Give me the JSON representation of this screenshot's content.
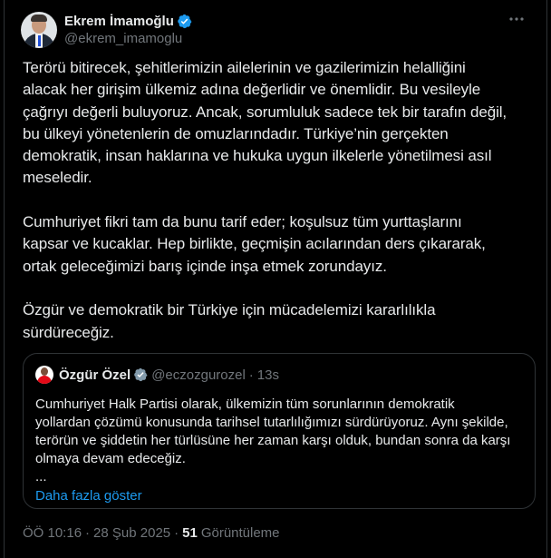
{
  "tweet": {
    "author": {
      "display_name": "Ekrem İmamoğlu",
      "handle": "@ekrem_imamoglu",
      "verified": true
    },
    "more_icon": "more-horizontal-icon",
    "paragraphs": [
      "Terörü bitirecek, şehitlerimizin ailelerinin ve gazilerimizin helalliğini\nalacak her girişim ülkemiz adına değerlidir ve önemlidir. Bu vesileyle\nçağrıyı değerli buluyoruz. Ancak, sorumluluk sadece tek bir tarafın değil,\nbu ülkeyi yönetenlerin de omuzlarındadır. Türkiye’nin gerçekten\ndemokratik, insan haklarına ve hukuka uygun ilkelerle yönetilmesi asıl\nmeseledir.",
      "Cumhuriyet fikri tam da bunu tarif eder; koşulsuz tüm yurttaşlarını\nkapsar ve kucaklar. Hep birlikte, geçmişin acılarından ders çıkararak,\nortak geleceğimizi barış içinde inşa etmek zorundayız.",
      "Özgür ve demokratik bir Türkiye için mücadelemizi kararlılıkla\nsürdüreceğiz."
    ],
    "quoted": {
      "display_name": "Özgür Özel",
      "handle": "@eczozgurozel",
      "dot": "·",
      "time": "13s",
      "text": "Cumhuriyet Halk Partisi olarak, ülkemizin tüm sorunlarının demokratik\nyollardan çözümü konusunda tarihsel tutarlılığımızı sürdürüyoruz. Aynı şekilde,\nterörün ve şiddetin her türlüsüne her zaman karşı olduk, bundan sonra da karşı\nolmaya devam edeceğiz.",
      "ellipsis": "...",
      "show_more": "Daha fazla göster"
    },
    "meta": {
      "time": "ÖÖ 10:16",
      "sep": "·",
      "date": "28 Şub 2025",
      "views_count": "51",
      "views_label": "Görüntüleme"
    },
    "colors": {
      "background": "#000000",
      "text": "#e7e9ea",
      "secondary": "#71767b",
      "link": "#1d9bf0",
      "border": "#2f3336",
      "verified": "#1d9bf0"
    }
  }
}
